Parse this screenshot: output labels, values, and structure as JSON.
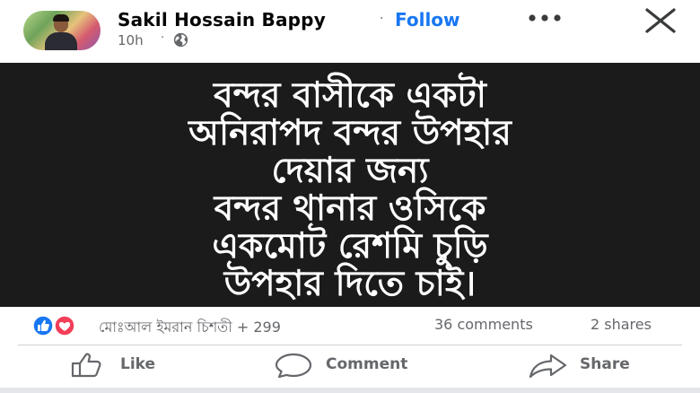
{
  "post": {
    "author": "Sakil Hossain Bappy",
    "separator": "·",
    "follow_label": "Follow",
    "timestamp": "10h",
    "time_separator": "·",
    "audience_icon": "globe-icon",
    "more_icon": "more-options-icon",
    "close_icon": "close-icon"
  },
  "image_text": {
    "lines": [
      "বন্দর বাসীকে একটা",
      "অনিরাপদ বন্দর উপহার",
      "দেয়ার জন্য",
      "বন্দর থানার ওসিকে",
      "একমোট রেশমি চুড়ি",
      "উপহার দিতে চাই।"
    ],
    "background": "#1b1b1b",
    "color": "#ffffff"
  },
  "stats": {
    "reactors": "মোঃআল ইমরান চিশতী + 299",
    "comments": "36 comments",
    "shares": "2 shares",
    "reaction_icons": [
      "like-reaction-icon",
      "love-reaction-icon"
    ]
  },
  "actions": {
    "like": "Like",
    "comment": "Comment",
    "share": "Share"
  },
  "colors": {
    "accent": "#1877f2",
    "secondary_text": "#65676b",
    "love": "#f33e58"
  }
}
